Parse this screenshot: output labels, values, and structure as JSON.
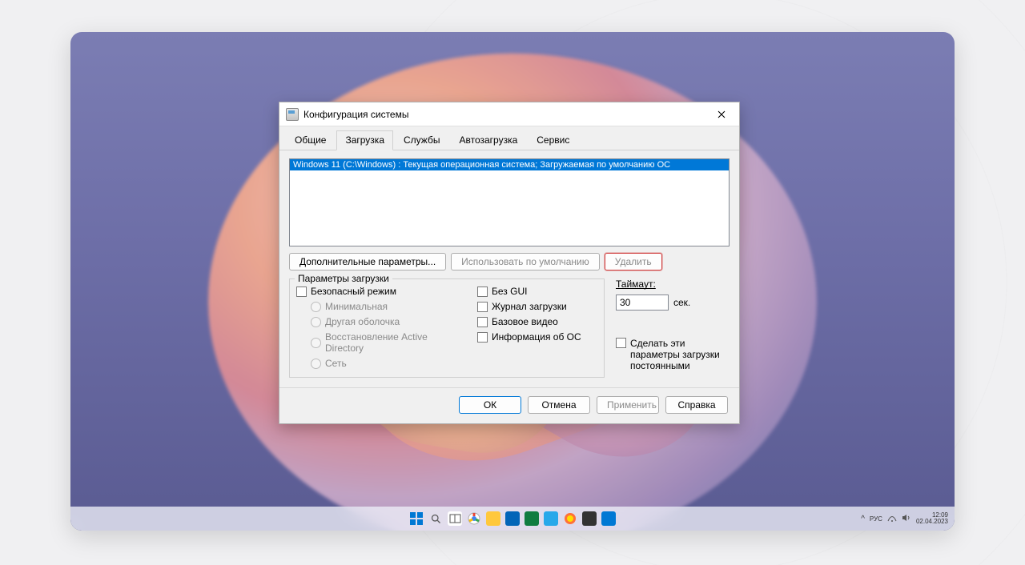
{
  "dialog": {
    "title": "Конфигурация системы",
    "tabs": [
      "Общие",
      "Загрузка",
      "Службы",
      "Автозагрузка",
      "Сервис"
    ],
    "active_tab_index": 1,
    "os_list_entry": "Windows 11 (C:\\Windows) : Текущая операционная система; Загружаемая по умолчанию ОС",
    "buttons": {
      "advanced": "Дополнительные параметры...",
      "set_default": "Использовать по умолчанию",
      "delete": "Удалить"
    },
    "group_title": "Параметры загрузки",
    "checkboxes": {
      "safeboot": "Безопасный режим",
      "minimal": "Минимальная",
      "altshell": "Другая оболочка",
      "dsrepair": "Восстановление Active Directory",
      "network": "Сеть",
      "nogui": "Без GUI",
      "bootlog": "Журнал загрузки",
      "basevideo": "Базовое видео",
      "osinfo": "Информация  об ОС"
    },
    "timeout": {
      "label": "Таймаут:",
      "value": "30",
      "suffix": "сек."
    },
    "make_permanent": "Сделать эти параметры загрузки постоянными",
    "bottom": {
      "ok": "ОК",
      "cancel": "Отмена",
      "apply": "Применить",
      "help": "Справка"
    }
  },
  "taskbar": {
    "systray": {
      "chevron": "^",
      "lang": "РУС",
      "net": "⏚",
      "vol": "🔊",
      "time": "12:09",
      "date": "02.04.2023"
    }
  }
}
